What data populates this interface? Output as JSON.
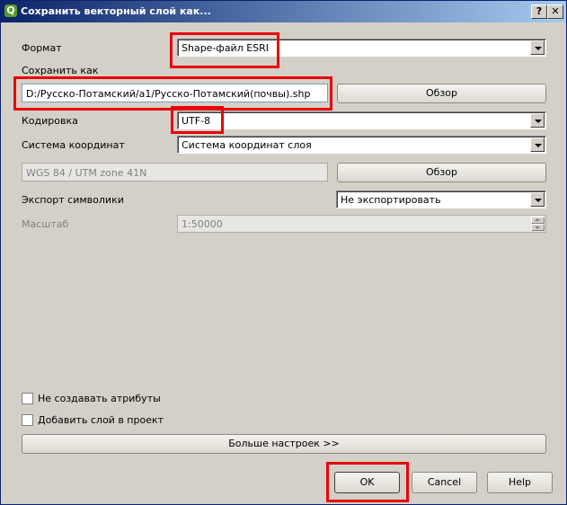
{
  "window": {
    "title": "Сохранить векторный слой как...",
    "icon": "qgis-icon",
    "help_glyph": "?",
    "close_glyph": "✕"
  },
  "form": {
    "format_label": "Формат",
    "format_value": "Shape-файл ESRI",
    "save_as_label": "Сохранить как",
    "save_as_value": "D:/Русско-Потамский/a1/Русско-Потамский(почвы).shp",
    "browse_label": "Обзор",
    "encoding_label": "Кодировка",
    "encoding_value": "UTF-8",
    "crs_label": "Система координат",
    "crs_value": "Система координат слоя",
    "crs_display": "WGS 84 / UTM zone 41N",
    "crs_browse_label": "Обзор",
    "symbology_label": "Экспорт символики",
    "symbology_value": "Не экспортировать",
    "scale_label": "Масштаб",
    "scale_value": "1:50000"
  },
  "options": {
    "no_attributes_label": "Не создавать атрибуты",
    "no_attributes_checked": false,
    "add_to_project_label": "Добавить слой в проект",
    "add_to_project_checked": false,
    "more_settings_label": "Больше настроек >>"
  },
  "buttons": {
    "ok": "OK",
    "cancel": "Cancel",
    "help": "Help"
  },
  "annotation_color": "#e8000b"
}
